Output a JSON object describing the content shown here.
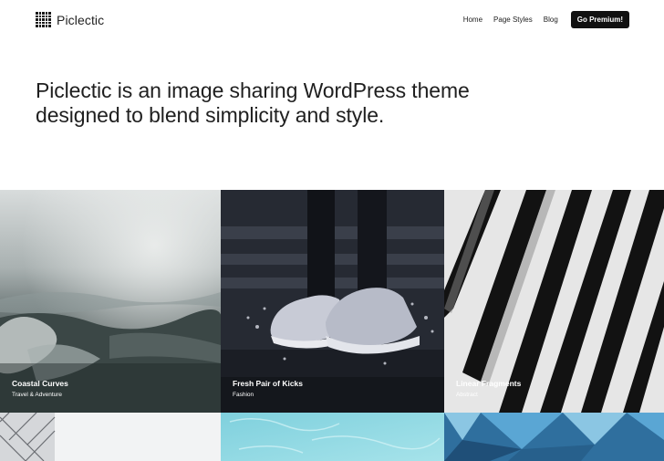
{
  "site": {
    "title": "Piclectic"
  },
  "nav": {
    "items": [
      "Home",
      "Page Styles",
      "Blog"
    ],
    "cta_label": "Go Premium!"
  },
  "hero": {
    "line1": "Piclectic is an image sharing WordPress theme",
    "line2": "designed to blend simplicity and style."
  },
  "grid": {
    "tiles": [
      {
        "title": "Coastal Curves",
        "category": "Travel & Adventure"
      },
      {
        "title": "Fresh Pair of Kicks",
        "category": "Fashion"
      },
      {
        "title": "Linear Fragments",
        "category": "Abstract"
      }
    ]
  },
  "icons": {
    "logo": "grid-logo-icon"
  },
  "colors": {
    "text": "#1a1a1a",
    "cta_bg": "#111111",
    "cta_text": "#ffffff",
    "background": "#ffffff"
  }
}
